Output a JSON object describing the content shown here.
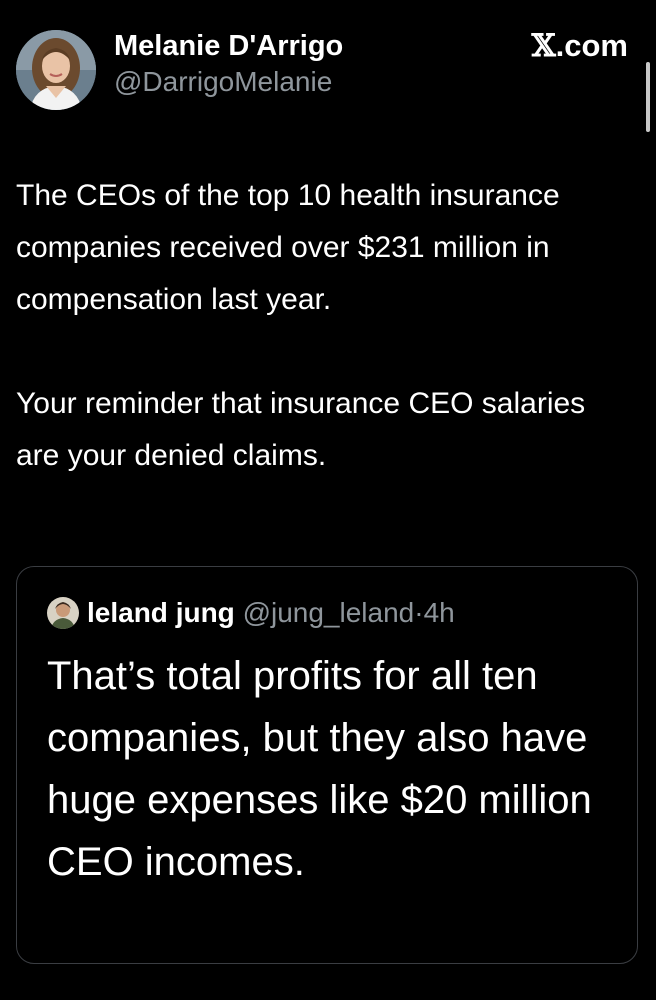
{
  "header": {
    "display_name": "Melanie D'Arrigo",
    "handle": "@DarrigoMelanie",
    "site_glyph": "𝕏",
    "site_suffix": ".com",
    "avatar_icon": "profile-photo-avatar"
  },
  "tweet": {
    "paragraph_1": "The CEOs of the top 10 health insurance companies received over $231 million in compensation last year.",
    "paragraph_2": "Your reminder that insurance CEO salaries are your denied claims."
  },
  "quoted_tweet": {
    "name": "leland jung",
    "handle": "@jung_leland",
    "separator": "·",
    "time": "4h",
    "text": "That’s total profits for all ten companies, but they also have huge expenses like $20 million CEO incomes.",
    "avatar_icon": "profile-photo-avatar"
  },
  "colors": {
    "background": "#000000",
    "primary_text": "#ffffff",
    "secondary_text": "#8f969c",
    "quote_border": "#3a3d42"
  }
}
